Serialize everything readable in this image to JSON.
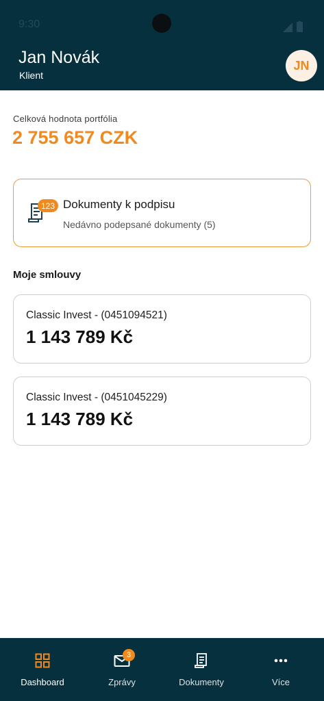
{
  "status_bar": {
    "time": "9:30"
  },
  "header": {
    "name": "Jan Novák",
    "role": "Klient",
    "avatar_initials": "JN"
  },
  "portfolio": {
    "label": "Celková hodnota portfólia",
    "value": "2 755 657 CZK"
  },
  "documents_card": {
    "badge": "123",
    "title": "Dokumenty k podpisu",
    "subtitle": "Nedávno podepsané dokumenty (5)",
    "icon": "document-icon"
  },
  "contracts": {
    "title": "Moje smlouvy",
    "items": [
      {
        "name": "Classic Invest - (0451094521)",
        "value": "1 143 789 Kč"
      },
      {
        "name": "Classic Invest - (0451045229)",
        "value": "1 143 789 Kč"
      }
    ]
  },
  "bottom_nav": {
    "items": [
      {
        "label": "Dashboard",
        "icon": "dashboard-grid-icon",
        "active": true
      },
      {
        "label": "Zprávy",
        "icon": "envelope-icon",
        "badge": "3"
      },
      {
        "label": "Dokumenty",
        "icon": "document-icon"
      },
      {
        "label": "Více",
        "icon": "more-dots-icon"
      }
    ]
  },
  "colors": {
    "primary_dark": "#06303d",
    "accent": "#f08a1e",
    "avatar_bg": "#fcefe3"
  }
}
